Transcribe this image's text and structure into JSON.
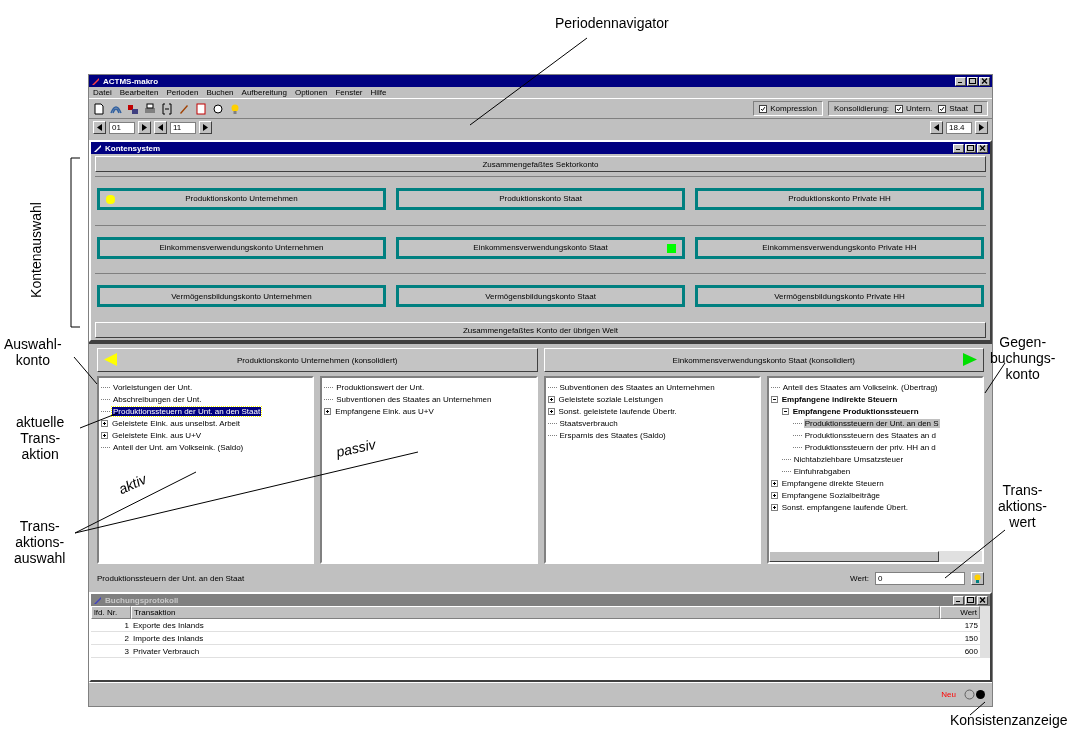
{
  "window": {
    "title": "ACTMS-makro"
  },
  "menu": [
    "Datei",
    "Bearbeiten",
    "Perioden",
    "Buchen",
    "Aufbereitung",
    "Optionen",
    "Fenster",
    "Hilfe"
  ],
  "toolbar": {
    "compression": {
      "label": "Kompression",
      "checked": true
    },
    "consolidation_label": "Konsolidierung:",
    "consolidation": [
      {
        "label": "Untern.",
        "checked": true
      },
      {
        "label": "Staat",
        "checked": true
      },
      {
        "checked": false
      }
    ]
  },
  "period_navigator": {
    "from": "01",
    "to": "11",
    "current": "18.4"
  },
  "account_system": {
    "title": "Kontensystem",
    "active": true,
    "top_button": "Zusammengefaßtes Sektorkonto",
    "rows": [
      [
        {
          "label": "Produktionskonto Unternehmen",
          "is_source": true,
          "is_target": false
        },
        {
          "label": "Produktionskonto Staat",
          "is_source": false,
          "is_target": false
        },
        {
          "label": "Produktionskonto Private HH",
          "is_source": false,
          "is_target": false
        }
      ],
      [
        {
          "label": "Einkommensverwendungskonto Unternehmen",
          "is_source": false,
          "is_target": false
        },
        {
          "label": "Einkommensverwendungskonto Staat",
          "is_source": false,
          "is_target": true
        },
        {
          "label": "Einkommensverwendungskonto Private HH",
          "is_source": false,
          "is_target": false
        }
      ],
      [
        {
          "label": "Vermögensbildungskonto Unternehmen",
          "is_source": false,
          "is_target": false
        },
        {
          "label": "Vermögensbildungskonto Staat",
          "is_source": false,
          "is_target": false
        },
        {
          "label": "Vermögensbildungskonto Private HH",
          "is_source": false,
          "is_target": false
        }
      ]
    ],
    "bottom_button": "Zusammengefaßtes Konto der übrigen Welt"
  },
  "booking": {
    "source": {
      "header": "Produktionskonto Unternehmen (konsolidiert)",
      "focused": true,
      "active": [
        {
          "label": "Vorleistungen der Unt.",
          "selected": false
        },
        {
          "label": "Abschreibungen der Unt.",
          "selected": false
        },
        {
          "label": "Produktionssteuern der Unt. an den Staat",
          "selected": true
        },
        {
          "label": "Geleistete Eink. aus unselbst. Arbeit",
          "expanded": false,
          "selected": false
        },
        {
          "label": "Geleistete Eink. aus U+V",
          "expanded": false,
          "selected": false
        },
        {
          "label": "Anteil der Unt. am Volkseink. (Saldo)",
          "selected": false
        }
      ],
      "passive": [
        {
          "label": "Produktionswert der Unt.",
          "selected": false
        },
        {
          "label": "Subventionen des Staates an Unternehmen",
          "selected": false
        },
        {
          "label": "Empfangene Eink. aus U+V",
          "expanded": false,
          "selected": false
        }
      ]
    },
    "target": {
      "header": "Einkommensverwendungskonto Staat (konsolidiert)",
      "focused": false,
      "active": [
        {
          "label": "Subventionen des Staates an Unternehmen",
          "selected": false
        },
        {
          "label": "Geleistete soziale Leistungen",
          "expanded": false,
          "selected": false
        },
        {
          "label": "Sonst. geleistete laufende Übertr.",
          "expanded": false,
          "selected": false
        },
        {
          "label": "Staatsverbrauch",
          "selected": false
        },
        {
          "label": "Ersparnis des Staates (Saldo)",
          "selected": false
        }
      ],
      "passive": [
        {
          "label": "Anteil des Staates am Volkseink. (Übertrag)",
          "selected": false
        },
        {
          "label": "Empfangene indirekte Steuern",
          "expanded": true,
          "selected": false,
          "children": [
            {
              "label": "Empfangene Produktionssteuern",
              "expanded": true,
              "selected": false,
              "children": [
                {
                  "label": "Produktionssteuern der Unt. an den S",
                  "selected": true
                },
                {
                  "label": "Produktionssteuern des Staates an d",
                  "selected": false
                },
                {
                  "label": "Produktionssteuern der priv. HH an d",
                  "selected": false
                }
              ]
            },
            {
              "label": "Nichtabziehbare Umsatzsteuer",
              "selected": false
            },
            {
              "label": "Einfuhrabgaben",
              "selected": false
            }
          ]
        },
        {
          "label": "Empfangene direkte Steuern",
          "expanded": false,
          "selected": false
        },
        {
          "label": "Empfangene Sozialbeiträge",
          "expanded": false,
          "selected": false
        },
        {
          "label": "Sonst. empfangene laufende Übert.",
          "expanded": false,
          "selected": false
        }
      ]
    },
    "status_text": "Produktionssteuern der Unt. an den Staat",
    "value_label": "Wert:",
    "value": "0"
  },
  "log": {
    "title": "Buchungsprotokoll",
    "active": false,
    "columns": [
      "lfd. Nr.",
      "Transaktion",
      "Wert"
    ],
    "rows": [
      [
        "1",
        "Exporte des Inlands",
        "175"
      ],
      [
        "2",
        "Importe des Inlands",
        "150"
      ],
      [
        "3",
        "Privater Verbrauch",
        "600"
      ]
    ]
  },
  "status_bar": {
    "state": "Neu"
  },
  "annotations": [
    {
      "lines": [
        "Periodennavigator"
      ]
    },
    {
      "lines": [
        "Kontenauswahl"
      ]
    },
    {
      "lines": [
        "Auswahl-",
        "konto"
      ]
    },
    {
      "lines": [
        "aktuelle",
        "Trans-",
        "aktion"
      ]
    },
    {
      "lines": [
        "aktiv"
      ]
    },
    {
      "lines": [
        "passiv"
      ]
    },
    {
      "lines": [
        "Trans-",
        "aktions-",
        "auswahl"
      ]
    },
    {
      "lines": [
        "Gegen-",
        "buchungs-",
        "konto"
      ]
    },
    {
      "lines": [
        "Trans-",
        "aktions-",
        "wert"
      ]
    },
    {
      "lines": [
        "Konsistenzanzeige"
      ]
    }
  ]
}
